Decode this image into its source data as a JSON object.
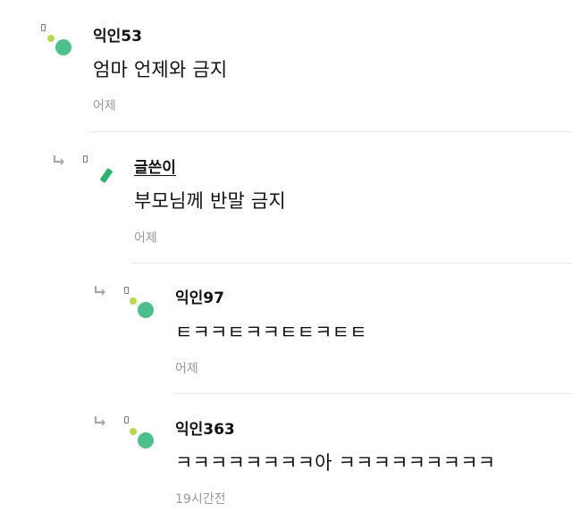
{
  "comments": [
    {
      "nickname": "익인53",
      "text": "엄마 언제와 금지",
      "time": "어제",
      "is_author": false
    },
    {
      "nickname": "글쓴이",
      "text": "부모님께 반말 금지",
      "time": "어제",
      "is_author": true
    },
    {
      "nickname": "익인97",
      "text": "ㅌㅋㅋㅌㅋㅋㅌㅌㅋㅌㅌ",
      "time": "어제",
      "is_author": false
    },
    {
      "nickname": "익인363",
      "text": "ㅋㅋㅋㅋㅋㅋㅋㅋ아 ㅋㅋㅋㅋㅋㅋㅋㅋㅋ",
      "time": "19시간전",
      "is_author": false
    }
  ],
  "colors": {
    "avatar_green": "#4cc08a",
    "avatar_lime": "#b6d94a",
    "author_badge": "#2db36f",
    "meta_gray": "#9a9a9a"
  },
  "icons": {
    "reply": "reply-arrow-icon",
    "avatar": "avatar-icon",
    "author_avatar": "author-avatar-icon",
    "broken_image": "broken-image-icon"
  }
}
